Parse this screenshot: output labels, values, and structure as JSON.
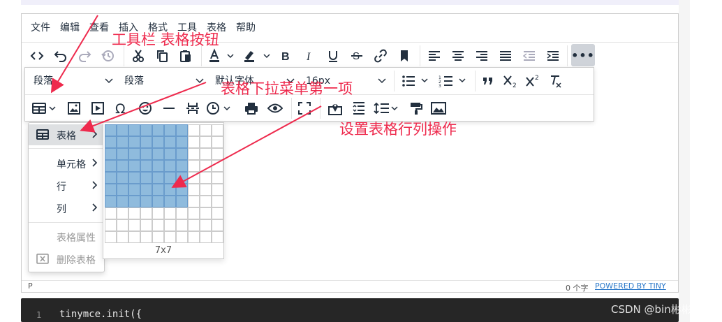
{
  "menubar": {
    "items": [
      "文件",
      "编辑",
      "查看",
      "插入",
      "格式",
      "工具",
      "表格",
      "帮助"
    ]
  },
  "toolbar": {
    "overflow_label": "•••",
    "block_format": "段落",
    "block_format2": "段落",
    "font_family": "默认字体",
    "font_size": "16px"
  },
  "annotations": {
    "toolbar_table_button": "工具栏 表格按钮",
    "first_dropdown_item": "表格下拉菜单第一项",
    "row_col_ops": "设置表格行列操作"
  },
  "table_menu": {
    "items": [
      {
        "label": "表格",
        "has_submenu": true,
        "active": true
      },
      {
        "label": "单元格",
        "has_submenu": true
      },
      {
        "label": "行",
        "has_submenu": true
      },
      {
        "label": "列",
        "has_submenu": true
      },
      {
        "label": "表格属性",
        "disabled": true
      },
      {
        "label": "删除表格",
        "disabled": true
      }
    ]
  },
  "table_grid": {
    "size_label": "7x7",
    "rows": 10,
    "cols": 10,
    "selected_rows": 7,
    "selected_cols": 7
  },
  "statusbar": {
    "path": "P",
    "word_count": "0 个字",
    "brand": "POWERED BY TINY"
  },
  "code": {
    "line_number": "1",
    "text": "tinymce.init({"
  },
  "watermark": "CSDN @bin彬彬彬",
  "colors": {
    "accent": "#ee2a4d",
    "grid_selected": "#8fbbdd",
    "link": "#2a78c9",
    "code_bg": "#262626"
  }
}
